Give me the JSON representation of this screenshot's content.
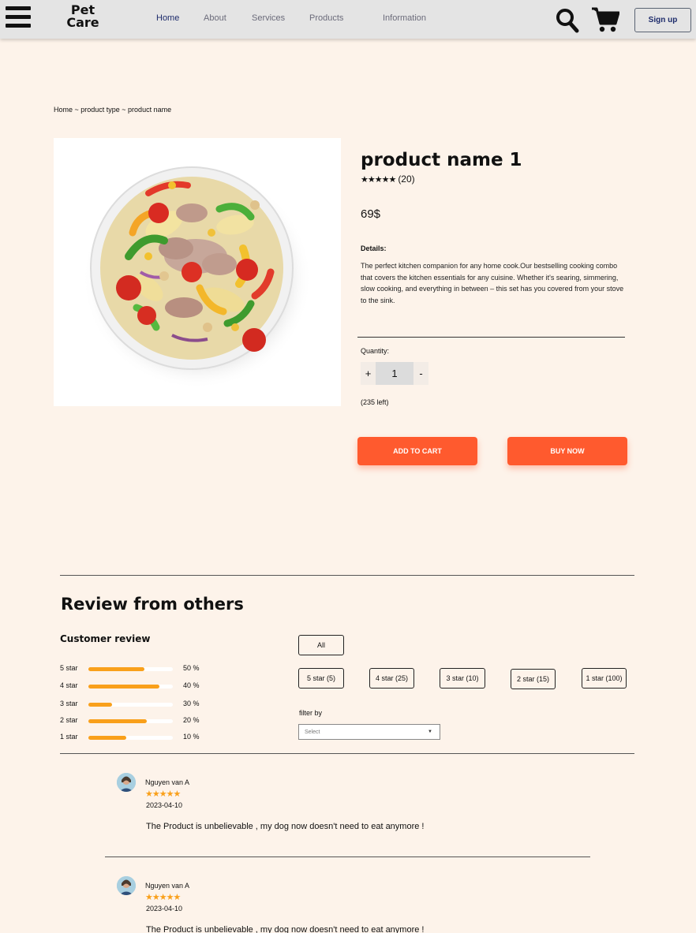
{
  "header": {
    "logo": "Pet Care",
    "nav": [
      "Home",
      "About",
      "Services",
      "Products",
      "Information"
    ],
    "signup": "Sign up"
  },
  "breadcrumb": "Home ~ product type ~ product name",
  "product": {
    "name": "product name 1",
    "rating_count": "(20)",
    "stars": "★★★★★",
    "price": "69$",
    "details_label": "Details:",
    "details": "The perfect kitchen companion for any home cook.Our bestselling cooking combo that covers the kitchen essentials for any cuisine. Whether it's searing, simmering, slow cooking, and everything in between – this set has you covered from your stove to the sink.",
    "quantity_label": "Quantity:",
    "quantity": "1",
    "plus": "+",
    "minus": "-",
    "stock": "(235 left)",
    "add_to_cart": "ADD TO CART",
    "buy_now": "BUY NOW"
  },
  "reviews": {
    "title": "Review from others",
    "customer_title": "Customer review",
    "bars": [
      {
        "label": "5 star",
        "pct": "50 %",
        "fill": 0.66
      },
      {
        "label": "4 star",
        "pct": "40 %",
        "fill": 0.84
      },
      {
        "label": "3 star",
        "pct": "30 %",
        "fill": 0.28
      },
      {
        "label": "2 star",
        "pct": "20 %",
        "fill": 0.69
      },
      {
        "label": "1 star",
        "pct": "10 %",
        "fill": 0.45
      }
    ],
    "filter_all": "All",
    "filters": [
      "5 star (5)",
      "4 star (25)",
      "3 star (10)",
      "2 star (15)",
      "1 star (100)"
    ],
    "filter_by": "filter by",
    "select_placeholder": "Select",
    "items": [
      {
        "name": "Nguyen van A",
        "stars": "★★★★★",
        "date": "2023-04-10",
        "text": "The Product is unbelievable , my dog now doesn't need to eat anymore !"
      },
      {
        "name": "Nguyen van A",
        "stars": "★★★★★",
        "date": "2023-04-10",
        "text": "The Product is unbelievable , my dog now doesn't need to eat anymore !"
      }
    ]
  }
}
